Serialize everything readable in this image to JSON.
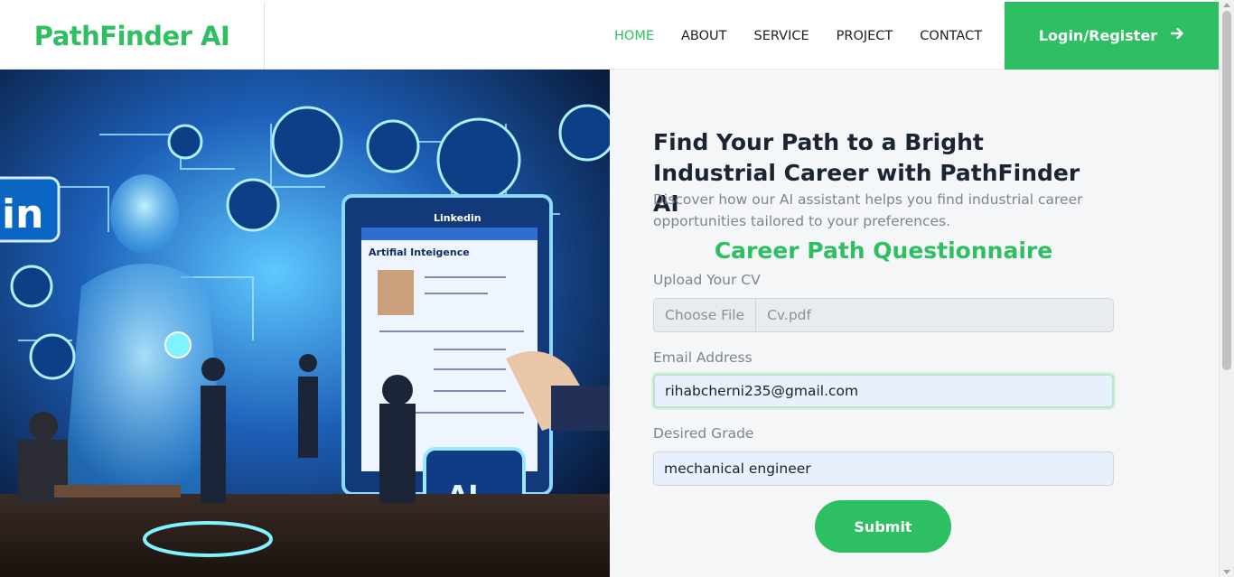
{
  "brand": "PathFinder AI",
  "nav": {
    "items": [
      {
        "label": "HOME",
        "active": true
      },
      {
        "label": "ABOUT"
      },
      {
        "label": "SERVICE"
      },
      {
        "label": "PROJECT"
      },
      {
        "label": "CONTACT"
      }
    ],
    "login_label": "Login/Register",
    "login_icon": "arrow-right-icon"
  },
  "hero": {
    "image_texts": [
      "Linkedin",
      "Artifial Inteigence",
      "AI"
    ]
  },
  "form_intro": {
    "headline": "Find Your Path to a Bright Industrial Career with PathFinder AI",
    "subtitle": "Discover how our AI assistant helps you find industrial career opportunities tailored to your preferences."
  },
  "form": {
    "title": "Career Path Questionnaire",
    "cv_label": "Upload Your CV",
    "file_button": "Choose File",
    "file_name": "Cv.pdf",
    "email_label": "Email Address",
    "email_value": "rihabcherni235@gmail.com",
    "grade_label": "Desired Grade",
    "grade_value": "mechanical engineer",
    "submit_label": "Submit"
  },
  "colors": {
    "accent": "#2fbf63",
    "heading": "#1b2433",
    "muted": "#7d8590",
    "panel_bg": "#f4f6f8"
  }
}
